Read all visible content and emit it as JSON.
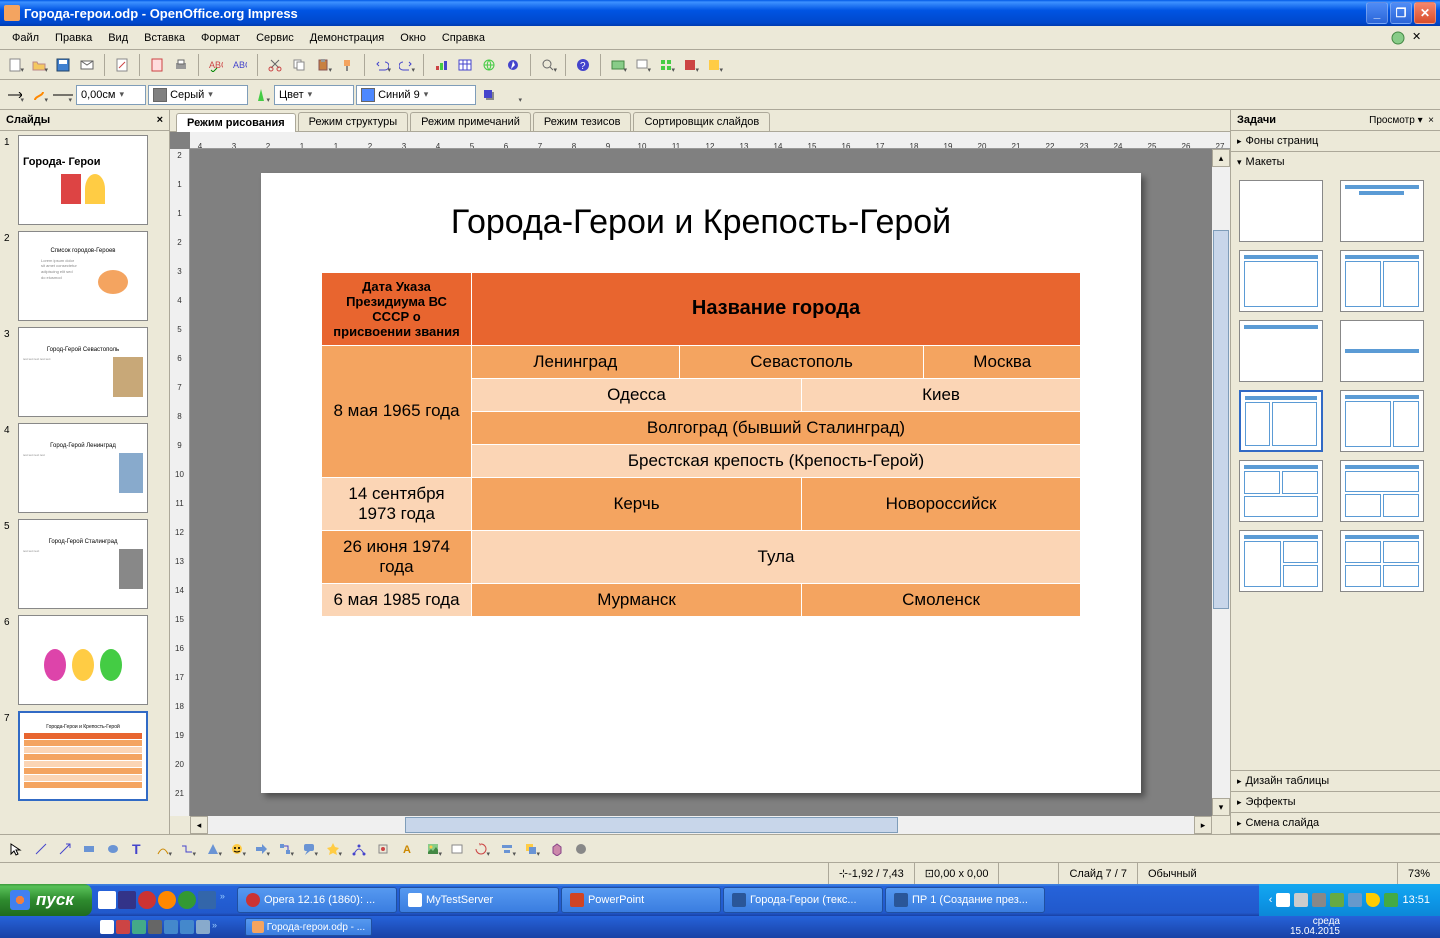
{
  "titlebar": {
    "title": "Города-герои.odp - OpenOffice.org Impress"
  },
  "menubar": {
    "items": [
      "Файл",
      "Правка",
      "Вид",
      "Вставка",
      "Формат",
      "Сервис",
      "Демонстрация",
      "Окно",
      "Справка"
    ]
  },
  "toolbar2": {
    "width_value": "0,00см",
    "color1_label": "Серый",
    "fill_label": "Цвет",
    "color2_label": "Синий 9"
  },
  "view_tabs": {
    "tabs": [
      "Режим рисования",
      "Режим структуры",
      "Режим примечаний",
      "Режим тезисов",
      "Сортировщик слайдов"
    ],
    "active": 0
  },
  "slides_panel": {
    "header": "Слайды",
    "thumbs": [
      {
        "num": "1",
        "title": "Города-\nГерои"
      },
      {
        "num": "2",
        "title": "Список городов-Героев"
      },
      {
        "num": "3",
        "title": "Город-Герой Севастополь"
      },
      {
        "num": "4",
        "title": "Город-Герой Ленинград"
      },
      {
        "num": "5",
        "title": "Город-Герой Сталинград"
      },
      {
        "num": "6",
        "title": ""
      },
      {
        "num": "7",
        "title": "Города-Герои и Крепость-Герой"
      }
    ],
    "selected": 7
  },
  "slide": {
    "title": "Города-Герои и Крепость-Герой",
    "header_date": "Дата Указа Президиума ВС СССР о присвоении звания",
    "header_city": "Название города",
    "rows": {
      "date1": "8 мая 1965 года",
      "r1c1": "Ленинград",
      "r1c2": "Севастополь",
      "r1c3": "Москва",
      "r2c1": "Одесса",
      "r2c2": "Киев",
      "r3": "Волгоград (бывший Сталинград)",
      "r4": "Брестская крепость (Крепость-Герой)",
      "date2": "14 сентября 1973 года",
      "r5c1": "Керчь",
      "r5c2": "Новороссийск",
      "date3": "26 июня 1974 года",
      "r6": "Тула",
      "date4": "6 мая 1985 года",
      "r7c1": "Мурманск",
      "r7c2": "Смоленск"
    }
  },
  "tasks_panel": {
    "header": "Задачи",
    "view_label": "Просмотр",
    "sections": {
      "backgrounds": "Фоны страниц",
      "layouts": "Макеты",
      "table_design": "Дизайн таблицы",
      "effects": "Эффекты",
      "slide_transition": "Смена слайда"
    }
  },
  "statusbar": {
    "coords": "-1,92 / 7,43",
    "size": "0,00 x 0,00",
    "slide_info": "Слайд 7 / 7",
    "mode": "Обычный",
    "zoom": "73%"
  },
  "taskbar": {
    "start": "пуск",
    "items": [
      "Opera 12.16 (1860): ...",
      "MyTestServer",
      "PowerPoint",
      "Города-Герои (текс...",
      "ПР 1 (Создание през..."
    ],
    "item2": "Города-герои.odp - ...",
    "clock_time": "13:51",
    "clock_day": "среда",
    "clock_date": "15.04.2015"
  }
}
